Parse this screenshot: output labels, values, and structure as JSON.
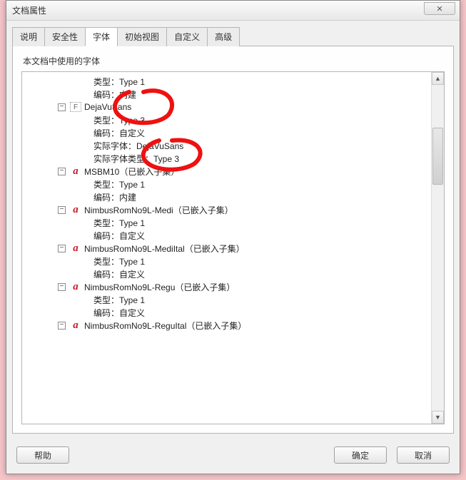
{
  "window": {
    "title": "文档属性",
    "close_glyph": "✕"
  },
  "tabs": {
    "items": [
      {
        "label": "说明"
      },
      {
        "label": "安全性"
      },
      {
        "label": "字体"
      },
      {
        "label": "初始视图"
      },
      {
        "label": "自定义"
      },
      {
        "label": "高级"
      }
    ],
    "active_index": 2
  },
  "panel": {
    "header": "本文档中使用的字体"
  },
  "tree": [
    {
      "kind": "prop",
      "label": "类型：Type 1"
    },
    {
      "kind": "prop",
      "label": "编码：内建"
    },
    {
      "kind": "font",
      "icon": "f",
      "name": "DejaVuSans"
    },
    {
      "kind": "prop",
      "label": "类型：Type 3"
    },
    {
      "kind": "prop",
      "label": "编码：自定义"
    },
    {
      "kind": "prop",
      "label": "实际字体：DejaVuSans"
    },
    {
      "kind": "prop",
      "label": "实际字体类型：Type 3"
    },
    {
      "kind": "font",
      "icon": "a",
      "name": "MSBM10（已嵌入子集）"
    },
    {
      "kind": "prop",
      "label": "类型：Type 1"
    },
    {
      "kind": "prop",
      "label": "编码：内建"
    },
    {
      "kind": "font",
      "icon": "a",
      "name": "NimbusRomNo9L-Medi（已嵌入子集）"
    },
    {
      "kind": "prop",
      "label": "类型：Type 1"
    },
    {
      "kind": "prop",
      "label": "编码：自定义"
    },
    {
      "kind": "font",
      "icon": "a",
      "name": "NimbusRomNo9L-MediItal（已嵌入子集）"
    },
    {
      "kind": "prop",
      "label": "类型：Type 1"
    },
    {
      "kind": "prop",
      "label": "编码：自定义"
    },
    {
      "kind": "font",
      "icon": "a",
      "name": "NimbusRomNo9L-Regu（已嵌入子集）"
    },
    {
      "kind": "prop",
      "label": "类型：Type 1"
    },
    {
      "kind": "prop",
      "label": "编码：自定义"
    },
    {
      "kind": "font",
      "icon": "a",
      "name": "NimbusRomNo9L-ReguItal（已嵌入子集）"
    }
  ],
  "buttons": {
    "help": "帮助",
    "ok": "确定",
    "cancel": "取消"
  },
  "scroll": {
    "up": "▲",
    "down": "▼"
  },
  "toggle_glyph": "−"
}
